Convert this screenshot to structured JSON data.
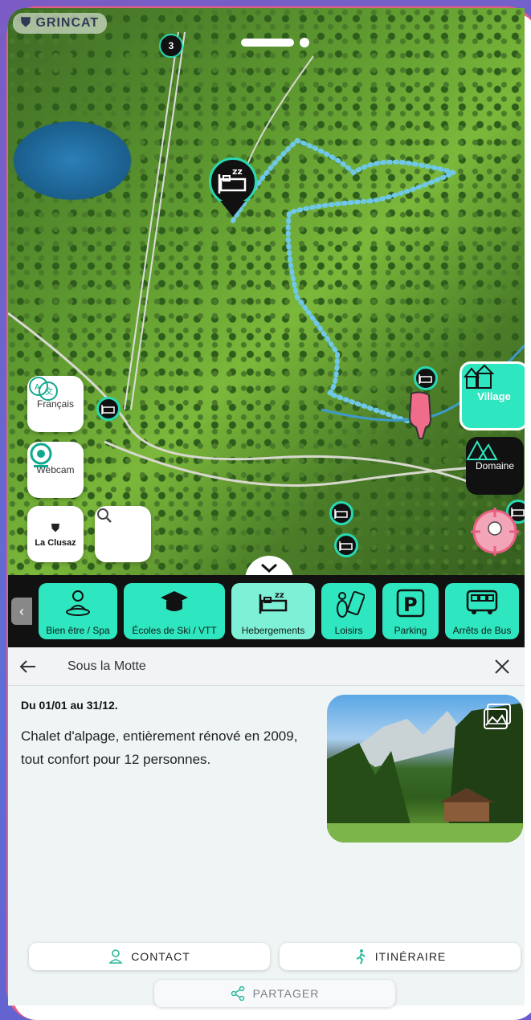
{
  "brand": "GRINCAT",
  "map": {
    "cluster_count": "3",
    "controls": {
      "language_label": "Français",
      "webcam_label": "Webcam",
      "logo_text": "La Clusaz"
    },
    "zones": {
      "village_label": "Village",
      "domaine_label": "Domaine"
    }
  },
  "categories": [
    {
      "label": "Bien être / Spa",
      "icon": "spa-person-icon"
    },
    {
      "label": "Écoles de Ski / VTT",
      "icon": "graduation-cap-icon"
    },
    {
      "label": "Hebergements",
      "icon": "bed-icon",
      "active": true
    },
    {
      "label": "Loisirs",
      "icon": "bowling-ticket-icon"
    },
    {
      "label": "Parking",
      "icon": "parking-icon"
    },
    {
      "label": "Arrêts de Bus",
      "icon": "bus-icon"
    }
  ],
  "detail": {
    "title": "Sous la Motte",
    "dates": "Du 01/01 au 31/12.",
    "description": "Chalet d'alpage, entièrement rénové en 2009, tout confort pour 12 personnes.",
    "buttons": {
      "contact": "CONTACT",
      "itinerary": "ITINÉRAIRE",
      "share": "PARTAGER"
    }
  },
  "colors": {
    "accent": "#2ee6bf",
    "frame": "#e85f82",
    "pin_dark": "#111111",
    "route_dots": "#6fc8e8"
  }
}
